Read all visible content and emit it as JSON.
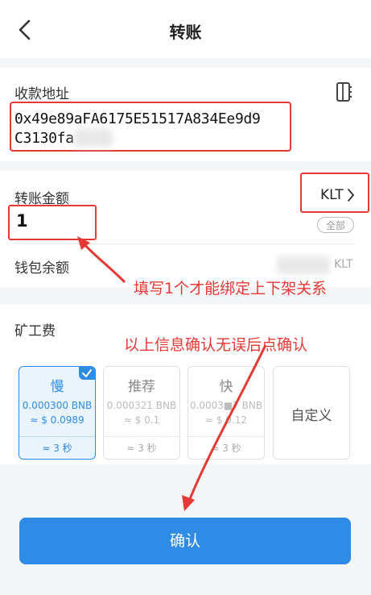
{
  "header": {
    "title": "转账"
  },
  "recipient": {
    "label": "收款地址",
    "address_line1": "0x49e89aFA6175E51517A834Ee9d9",
    "address_line2": "C3130fa"
  },
  "amount": {
    "label": "转账金额",
    "token": "KLT",
    "value": "1",
    "all_button": "全部"
  },
  "balance": {
    "label": "钱包余额",
    "unit": "KLT"
  },
  "fee": {
    "label": "矿工费",
    "options": [
      {
        "name": "慢",
        "amount": "0.000300 BNB",
        "usd": "≈ $ 0.0989",
        "time": "≈ 3 秒",
        "selected": true
      },
      {
        "name": "推荐",
        "amount": "0.000321 BNB",
        "usd": "≈ $ 0.1",
        "time": "≈ 3 秒",
        "selected": false
      },
      {
        "name": "快",
        "amount": "0.0003■7 BNB",
        "usd": "≈ $ 0.12",
        "time": "≈ 3 秒",
        "selected": false
      },
      {
        "name": "自定义"
      }
    ]
  },
  "annotations": {
    "note1": "填写1个才能绑定上下架关系",
    "note2": "以上信息确认无误后点确认",
    "color": "#e53935"
  },
  "confirm_button": "确认",
  "colors": {
    "accent": "#2f8ce6",
    "highlight": "#e53935"
  },
  "icons": {
    "back": "chevron-left-icon",
    "addressbook": "address-book-icon",
    "chevron": "chevron-right-icon",
    "check": "check-icon"
  }
}
